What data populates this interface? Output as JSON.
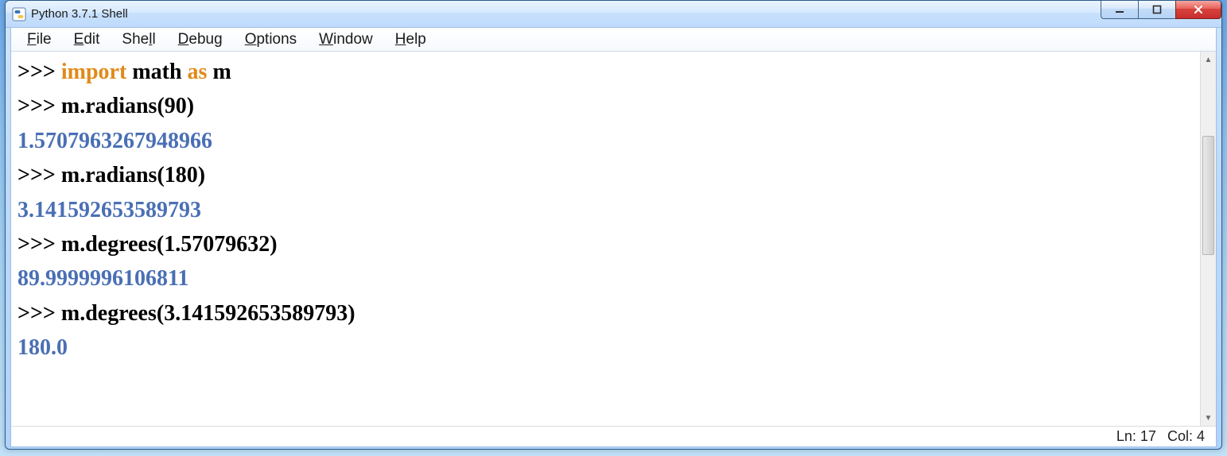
{
  "window": {
    "title": "Python 3.7.1 Shell"
  },
  "menu": {
    "file": {
      "label": "File",
      "accel": "F"
    },
    "edit": {
      "label": "Edit",
      "accel": "E"
    },
    "shell": {
      "label": "Shell",
      "accel": "l"
    },
    "debug": {
      "label": "Debug",
      "accel": "D"
    },
    "options": {
      "label": "Options",
      "accel": "O"
    },
    "window": {
      "label": "Window",
      "accel": "W"
    },
    "help": {
      "label": "Help",
      "accel": "H"
    }
  },
  "shell": {
    "prompt": ">>>",
    "lines": [
      {
        "type": "input",
        "tokens": [
          {
            "t": "kw",
            "v": "import"
          },
          {
            "t": "code",
            "v": " math "
          },
          {
            "t": "kw",
            "v": "as"
          },
          {
            "t": "code",
            "v": " m"
          }
        ]
      },
      {
        "type": "input",
        "tokens": [
          {
            "t": "code",
            "v": "m.radians(90)"
          }
        ]
      },
      {
        "type": "output",
        "value": "1.5707963267948966"
      },
      {
        "type": "input",
        "tokens": [
          {
            "t": "code",
            "v": "m.radians(180)"
          }
        ]
      },
      {
        "type": "output",
        "value": "3.141592653589793"
      },
      {
        "type": "input",
        "tokens": [
          {
            "t": "code",
            "v": "m.degrees(1.57079632)"
          }
        ]
      },
      {
        "type": "output",
        "value": "89.9999996106811"
      },
      {
        "type": "input",
        "tokens": [
          {
            "t": "code",
            "v": "m.degrees(3.141592653589793)"
          }
        ]
      },
      {
        "type": "output",
        "value": "180.0"
      }
    ]
  },
  "status": {
    "ln_label": "Ln:",
    "ln_value": "17",
    "col_label": "Col:",
    "col_value": "4"
  }
}
